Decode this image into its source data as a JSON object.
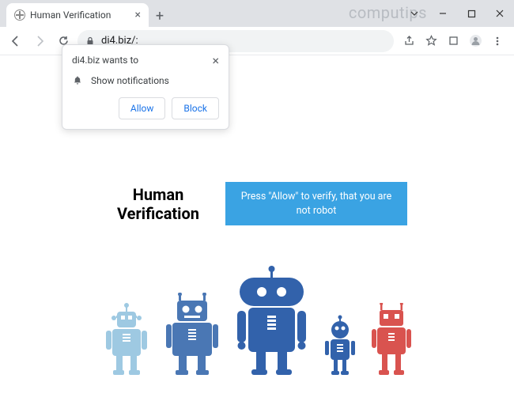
{
  "window": {
    "watermark": "computips"
  },
  "tab": {
    "title": "Human Verification"
  },
  "toolbar": {
    "url": "di4.biz/:"
  },
  "popup": {
    "title": "di4.biz wants to",
    "permission": "Show notifications",
    "allow": "Allow",
    "block": "Block"
  },
  "page": {
    "heading_line1": "Human",
    "heading_line2": "Verification",
    "instruction": "Press \"Allow\" to verify, that you are not robot"
  }
}
